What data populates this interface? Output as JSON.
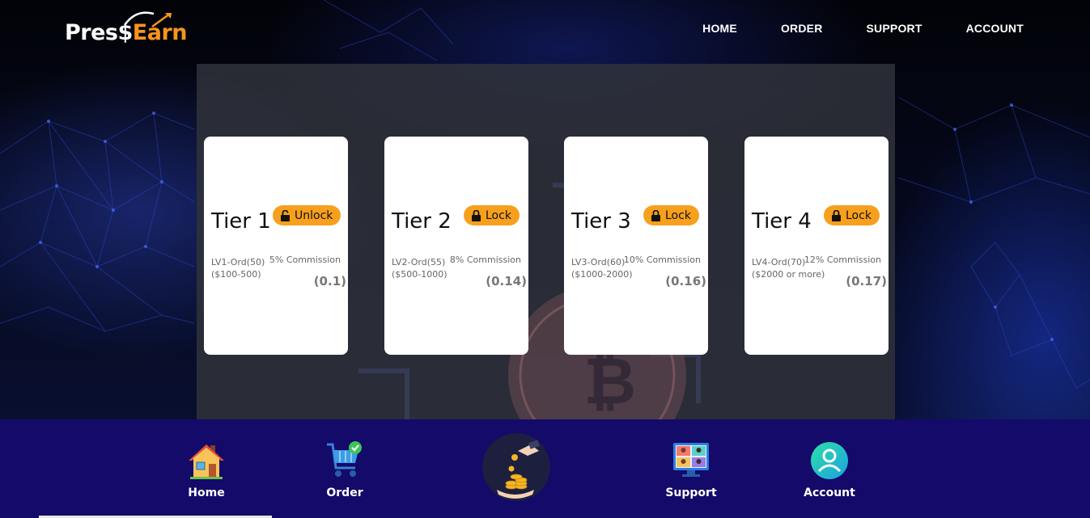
{
  "brand": {
    "logo_part1": "Pres$",
    "logo_part2": "Earn"
  },
  "nav": {
    "items": [
      "HOME",
      "ORDER",
      "SUPPORT",
      "ACCOUNT"
    ]
  },
  "tiers": [
    {
      "title": "Tier 1",
      "button": "Unlock",
      "button_icon": "unlock-icon",
      "level": "LV1-Ord(50)",
      "range": "($100-500)",
      "commission": "5% Commission",
      "rate": "(0.1)"
    },
    {
      "title": "Tier 2",
      "button": "Lock",
      "button_icon": "lock-icon",
      "level": "LV2-Ord(55)",
      "range": "($500-1000)",
      "commission": "8% Commission",
      "rate": "(0.14)"
    },
    {
      "title": "Tier 3",
      "button": "Lock",
      "button_icon": "lock-icon",
      "level": "LV3-Ord(60)",
      "range": "($1000-2000)",
      "commission": "10% Commission",
      "rate": "(0.16)"
    },
    {
      "title": "Tier 4",
      "button": "Lock",
      "button_icon": "lock-icon",
      "level": "LV4-Ord(70)",
      "range": "($2000 or more)",
      "commission": "12% Commission",
      "rate": "(0.17)"
    }
  ],
  "bottom_nav": {
    "items": [
      {
        "label": "Home",
        "icon": "house-icon"
      },
      {
        "label": "Order",
        "icon": "cart-icon"
      },
      {
        "label": "",
        "icon": "coins-hand-icon"
      },
      {
        "label": "Support",
        "icon": "support-screen-icon"
      },
      {
        "label": "Account",
        "icon": "user-icon"
      }
    ]
  },
  "colors": {
    "accent": "#f7a01d",
    "bottom_bar": "#130a6a",
    "panel": "#30323a"
  }
}
